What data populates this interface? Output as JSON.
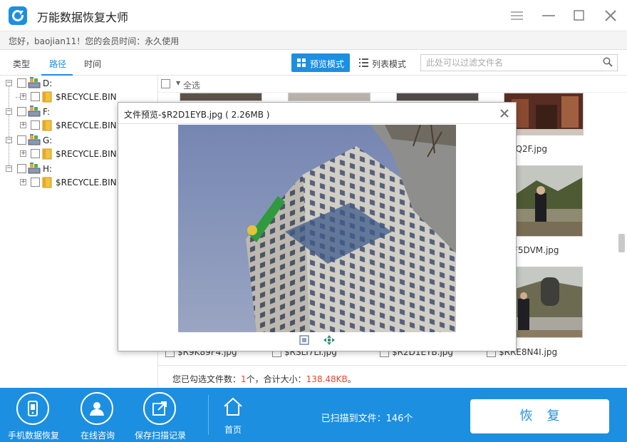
{
  "app": {
    "title": "万能数据恢复大师",
    "greeting": "您好，baojian11！您的会员时间：永久使用"
  },
  "tabs": [
    {
      "label": "类型"
    },
    {
      "label": "路径"
    },
    {
      "label": "时间"
    }
  ],
  "active_tab": "路径",
  "toolbar": {
    "preview_mode_label": "预览模式",
    "list_mode_label": "列表模式",
    "filter_placeholder": "此处可以过滤文件名"
  },
  "tree": [
    {
      "drive": "D:",
      "child": "$RECYCLE.BIN"
    },
    {
      "drive": "F:",
      "child": "$RECYCLE.BIN"
    },
    {
      "drive": "G:",
      "child": "$RECYCLE.BIN"
    },
    {
      "drive": "H:",
      "child": "$RECYCLE.BIN"
    }
  ],
  "file_grid": {
    "select_all_label": "全选",
    "visible_names": [
      "JQ2F.jpg",
      "F5DVM.jpg",
      "$R9K89F4.jpg",
      "$RSLI7LY.jpg",
      "$R2D1EYB.jpg",
      "$RRE8N4I.jpg"
    ]
  },
  "status": {
    "prefix": "您已勾选文件数：",
    "count": "1",
    "middle": "个，合计大小：",
    "size": "138.48KB",
    "suffix": "。"
  },
  "preview": {
    "title": "文件预览-$R2D1EYB.jpg ( 2.26MB )"
  },
  "bottom_bar": {
    "buttons": [
      {
        "label": "手机数据恢复",
        "icon": "phone-icon"
      },
      {
        "label": "在线咨询",
        "icon": "user-icon"
      },
      {
        "label": "保存扫描记录",
        "icon": "export-icon"
      }
    ],
    "home_label": "首页",
    "scan_count": "已扫描到文件：146个",
    "recover_label": "恢复"
  },
  "colors": {
    "accent": "#1c8fe0",
    "highlight": "#e2452f"
  }
}
